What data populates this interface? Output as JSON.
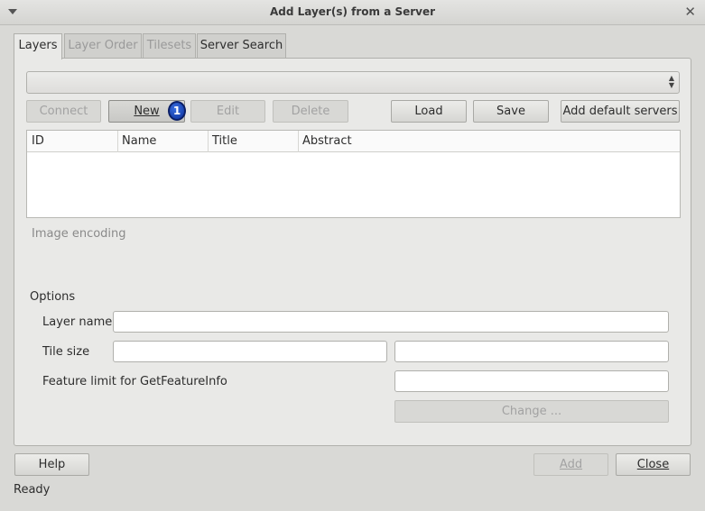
{
  "window": {
    "title": "Add Layer(s) from a Server"
  },
  "tabs": [
    {
      "label": "Layers",
      "active": true,
      "enabled": true
    },
    {
      "label": "Layer Order",
      "active": false,
      "enabled": false
    },
    {
      "label": "Tilesets",
      "active": false,
      "enabled": false
    },
    {
      "label": "Server Search",
      "active": false,
      "enabled": true
    }
  ],
  "server_combo": {
    "value": ""
  },
  "toolbar": {
    "connect": "Connect",
    "new": "New",
    "edit": "Edit",
    "delete": "Delete",
    "load": "Load",
    "save": "Save",
    "add_default": "Add default servers"
  },
  "annotation": {
    "step": "1"
  },
  "table": {
    "columns": [
      "ID",
      "Name",
      "Title",
      "Abstract"
    ],
    "rows": []
  },
  "image_encoding": {
    "label": "Image encoding"
  },
  "options": {
    "heading": "Options",
    "layer_name_label": "Layer name",
    "layer_name_value": "",
    "tile_size_label": "Tile size",
    "tile_width_value": "",
    "tile_height_value": "",
    "feature_limit_label": "Feature limit for GetFeatureInfo",
    "feature_limit_value": "",
    "change_label": "Change ..."
  },
  "footer": {
    "help": "Help",
    "add": "Add",
    "close": "Close"
  },
  "status": {
    "text": "Ready"
  },
  "colors": {
    "badge": "#0a2f9a",
    "window_bg": "#d9d9d6",
    "panel_bg": "#e9e9e7"
  }
}
